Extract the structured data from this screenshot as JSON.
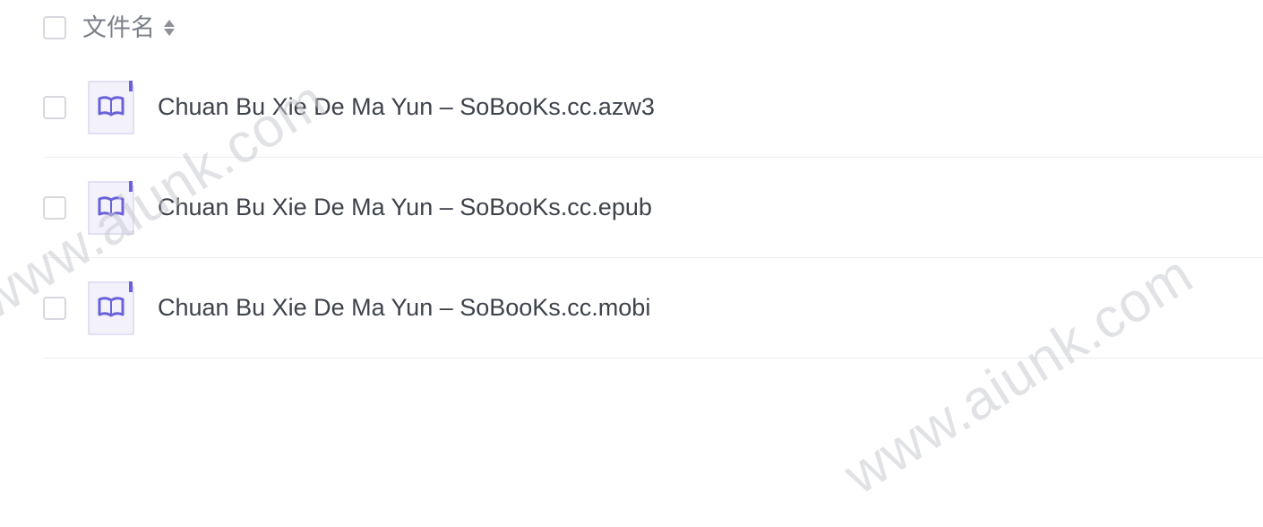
{
  "header": {
    "column_label": "文件名"
  },
  "files": [
    {
      "name": "Chuan Bu Xie De Ma Yun – SoBooKs.cc.azw3",
      "icon": "ebook-file-icon"
    },
    {
      "name": "Chuan Bu Xie De Ma Yun – SoBooKs.cc.epub",
      "icon": "ebook-file-icon"
    },
    {
      "name": "Chuan Bu Xie De Ma Yun – SoBooKs.cc.mobi",
      "icon": "ebook-file-icon"
    }
  ],
  "watermarks": [
    "www.aiunk.com",
    "www.aiunk.com"
  ],
  "colors": {
    "icon_accent": "#6a62d9",
    "icon_bg": "#f3f2fb",
    "checkbox_border": "#d6d8de",
    "divider": "#edeef1"
  }
}
